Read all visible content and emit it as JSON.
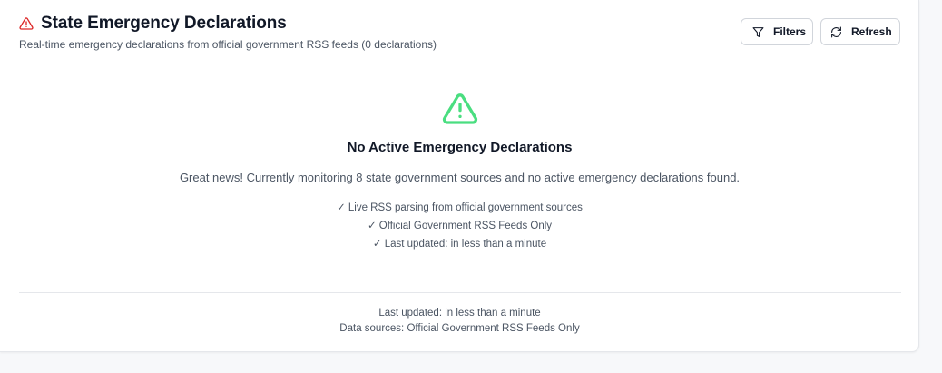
{
  "header": {
    "title": "State Emergency Declarations",
    "subtitle": "Real-time emergency declarations from official government RSS feeds (0 declarations)",
    "icon": "alert-triangle-icon",
    "icon_color": "#dc2626"
  },
  "actions": {
    "filters_label": "Filters",
    "filters_icon": "filter-icon",
    "refresh_label": "Refresh",
    "refresh_icon": "refresh-icon"
  },
  "empty_state": {
    "icon": "alert-triangle-icon",
    "icon_color": "#4ade80",
    "title": "No Active Emergency Declarations",
    "description": "Great news! Currently monitoring 8 state government sources and no active emergency declarations found.",
    "checks": [
      "✓ Live RSS parsing from official government sources",
      "✓ Official Government RSS Feeds Only",
      "✓ Last updated: in less than a minute"
    ]
  },
  "footer": {
    "last_updated": "Last updated: in less than a minute",
    "data_sources": "Data sources: Official Government RSS Feeds Only"
  }
}
